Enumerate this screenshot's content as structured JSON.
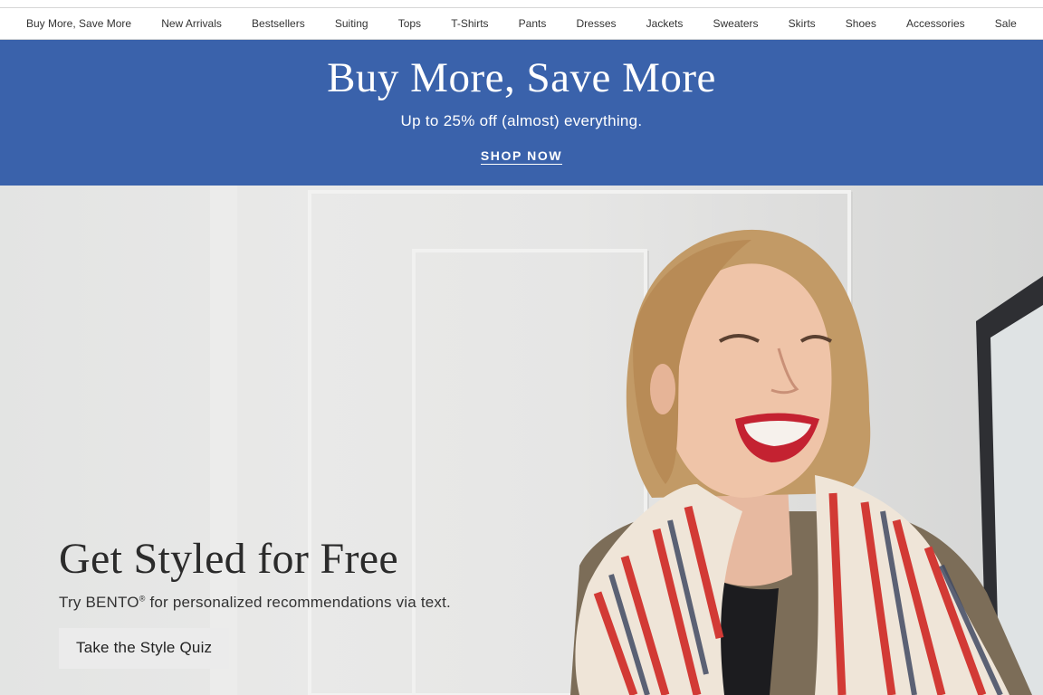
{
  "nav": {
    "items": [
      "Buy More, Save More",
      "New Arrivals",
      "Bestsellers",
      "Suiting",
      "Tops",
      "T-Shirts",
      "Pants",
      "Dresses",
      "Jackets",
      "Sweaters",
      "Skirts",
      "Shoes",
      "Accessories",
      "Sale"
    ]
  },
  "promo": {
    "title": "Buy More, Save More",
    "subtitle": "Up to 25% off (almost) everything.",
    "cta": "SHOP NOW",
    "background_color": "#3a62ab"
  },
  "hero": {
    "title": "Get Styled for Free",
    "description_prefix": "Try BENTO",
    "description_mark": "®",
    "description_suffix": " for personalized recommendations via text.",
    "button": "Take the Style Quiz",
    "image": "woman-smiling-striped-scarf"
  }
}
